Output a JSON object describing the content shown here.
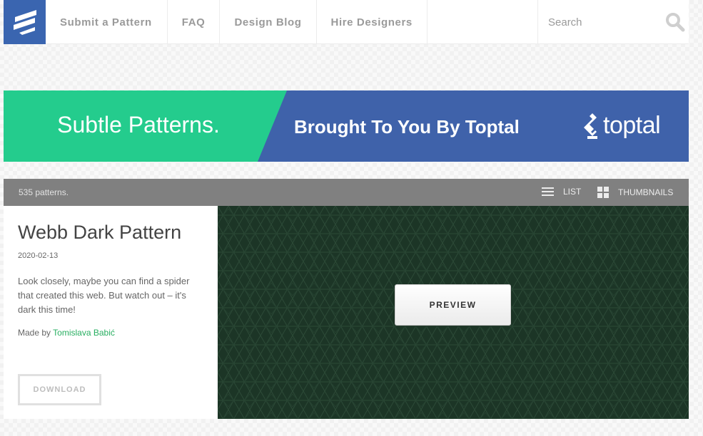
{
  "header": {
    "nav": [
      {
        "label": "Submit a Pattern"
      },
      {
        "label": "FAQ"
      },
      {
        "label": "Design Blog"
      },
      {
        "label": "Hire Designers"
      }
    ],
    "search": {
      "placeholder": "Search"
    }
  },
  "banner": {
    "left_text": "Subtle Patterns.",
    "mid_text": "Brought To You By Toptal",
    "logo_text": "toptal",
    "colors": {
      "green": "#24cc8d",
      "blue": "#3f62aa"
    }
  },
  "toolbar": {
    "count": "535 patterns.",
    "list_label": "LIST",
    "thumbnails_label": "THUMBNAILS"
  },
  "pattern": {
    "title": "Webb Dark Pattern",
    "date": "2020-02-13",
    "description": "Look closely, maybe you can find a spider that created this web. But watch out – it's dark this time!",
    "made_by_label": "Made by",
    "author": "Tomislava Babić",
    "download_label": "DOWNLOAD",
    "preview_label": "PREVIEW",
    "preview_color": "#1c3526"
  },
  "icons": {
    "logo": "subtle-patterns-logo-icon",
    "search": "magnifier-icon",
    "list": "list-icon",
    "thumbnails": "grid-icon",
    "toptal": "toptal-logo-icon"
  }
}
